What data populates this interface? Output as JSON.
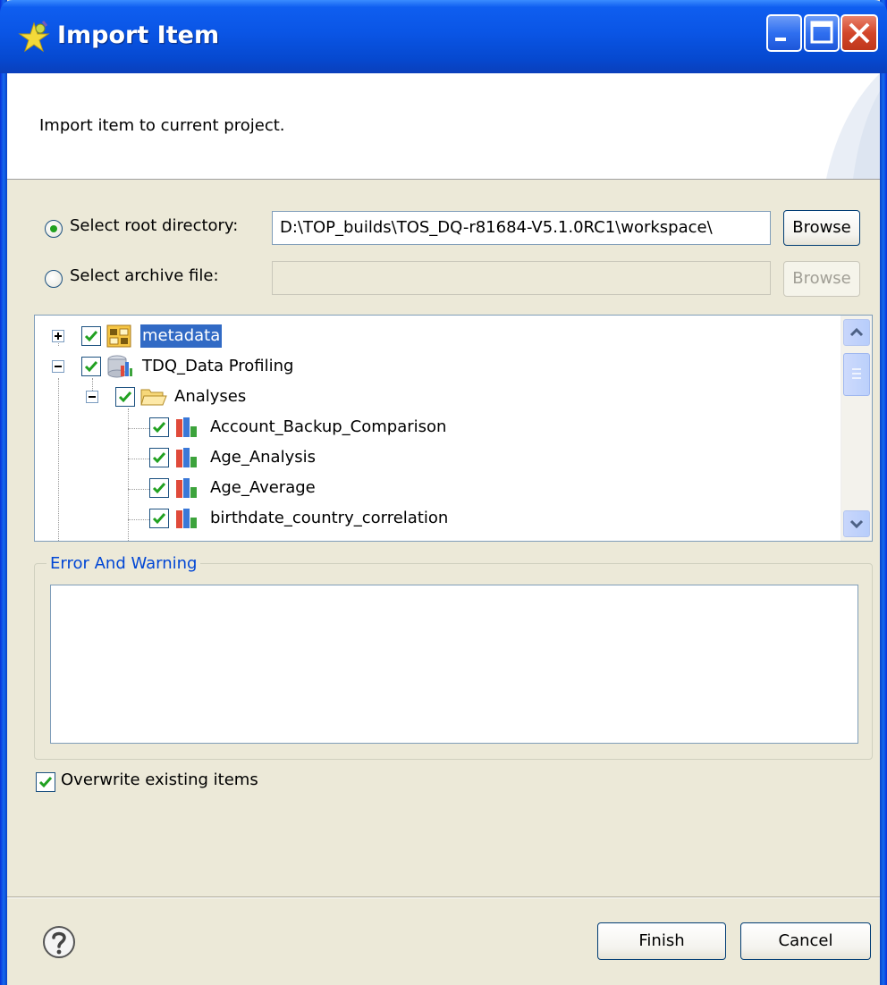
{
  "window": {
    "title": "Import Item",
    "minimize_icon": "minimize-icon",
    "maximize_icon": "maximize-icon",
    "close_icon": "close-icon"
  },
  "banner": {
    "description": "Import item to current project."
  },
  "source": {
    "root_directory_label": "Select root directory:",
    "root_directory_value": "D:\\TOP_builds\\TOS_DQ-r81684-V5.1.0RC1\\workspace\\",
    "root_directory_selected": true,
    "browse_label": "Browse",
    "archive_file_label": "Select archive file:",
    "archive_file_value": "",
    "archive_browse_label": "Browse"
  },
  "tree": {
    "nodes": [
      {
        "label": "metadata",
        "checked": true,
        "expanded": false,
        "selected": true,
        "icon": "metadata-icon"
      },
      {
        "label": "TDQ_Data Profiling",
        "checked": true,
        "expanded": true,
        "icon": "project-icon"
      },
      {
        "label": "Analyses",
        "checked": true,
        "expanded": true,
        "icon": "folder-icon"
      },
      {
        "label": "Account_Backup_Comparison",
        "checked": true,
        "icon": "analysis-icon"
      },
      {
        "label": "Age_Analysis",
        "checked": true,
        "icon": "analysis-icon"
      },
      {
        "label": "Age_Average",
        "checked": true,
        "icon": "analysis-icon"
      },
      {
        "label": "birthdate_country_correlation",
        "checked": true,
        "icon": "analysis-icon"
      }
    ]
  },
  "errors": {
    "group_title": "Error And Warning",
    "messages": ""
  },
  "options": {
    "overwrite_label": "Overwrite existing items",
    "overwrite_checked": true
  },
  "footer": {
    "help_icon": "help-icon",
    "finish_label": "Finish",
    "cancel_label": "Cancel"
  },
  "colors": {
    "titlebar": "#0a55e5",
    "selection": "#316ac5",
    "group_title": "#0046d5",
    "dialog_bg": "#ece9d8"
  }
}
